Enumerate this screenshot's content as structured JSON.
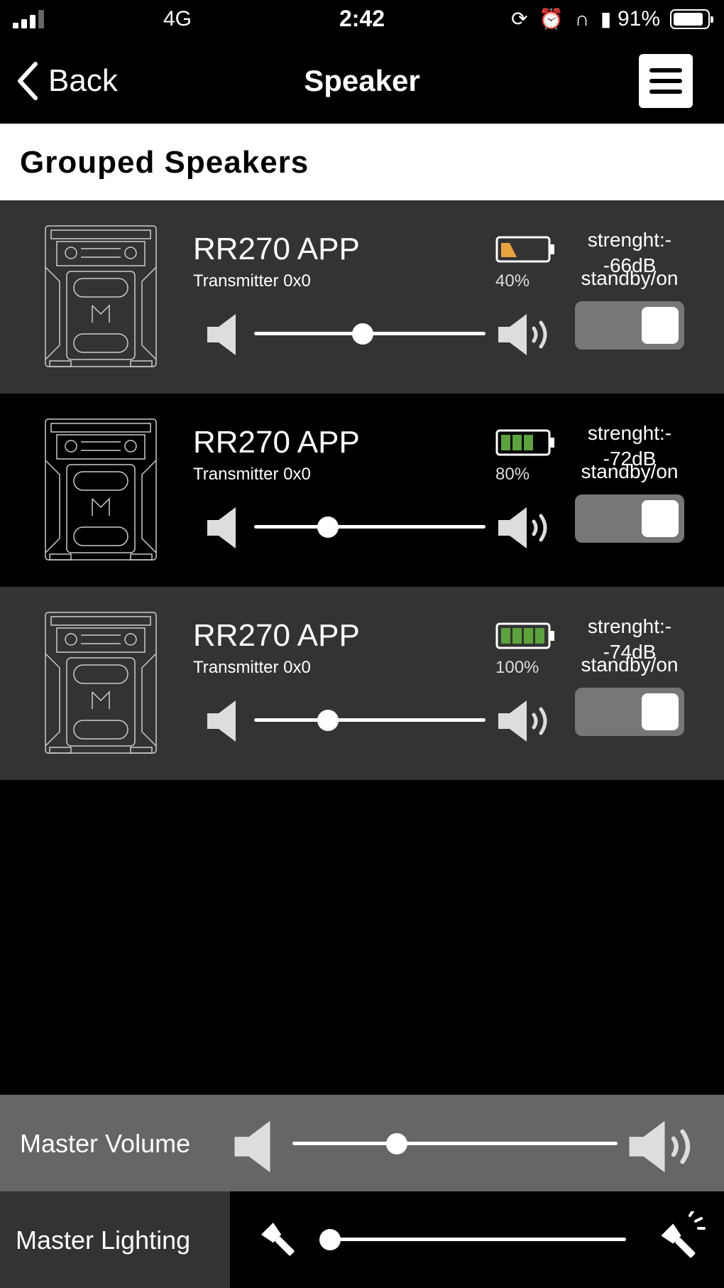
{
  "status_bar": {
    "network": "4G",
    "time": "2:42",
    "status_icons": [
      "orientation-lock-icon",
      "alarm-icon",
      "headphones-icon",
      "battery-small-icon"
    ],
    "battery_percent": "91%",
    "battery_level": 0.91
  },
  "nav": {
    "back_label": "Back",
    "title": "Speaker",
    "menu_icon": "hamburger-menu-icon"
  },
  "section": {
    "title": "Grouped Speakers"
  },
  "speakers": [
    {
      "name": "RR270 APP",
      "subtitle": "Transmitter 0x0",
      "battery_percent": "40%",
      "battery_level": 0.4,
      "battery_color": "#E8A33A",
      "strength": "strenght:-\n-66dB",
      "standby_label": "standby/on",
      "volume_level": 0.47,
      "toggle_on": true
    },
    {
      "name": "RR270 APP",
      "subtitle": "Transmitter 0x0",
      "battery_percent": "80%",
      "battery_level": 0.8,
      "battery_color": "#5BA33B",
      "strength": "strenght:-\n-72dB",
      "standby_label": "standby/on",
      "volume_level": 0.32,
      "toggle_on": true
    },
    {
      "name": "RR270 APP",
      "subtitle": "Transmitter 0x0",
      "battery_percent": "100%",
      "battery_level": 1.0,
      "battery_color": "#5BA33B",
      "strength": "strenght:-\n-74dB",
      "standby_label": "standby/on",
      "volume_level": 0.32,
      "toggle_on": true
    }
  ],
  "master_volume": {
    "label": "Master Volume",
    "level": 0.32
  },
  "master_lighting": {
    "label": "Master Lighting",
    "level": 0.03
  },
  "colors": {
    "row_gray": "#333333",
    "master_volume_bg": "#666666",
    "toggle_bg": "#777777"
  }
}
